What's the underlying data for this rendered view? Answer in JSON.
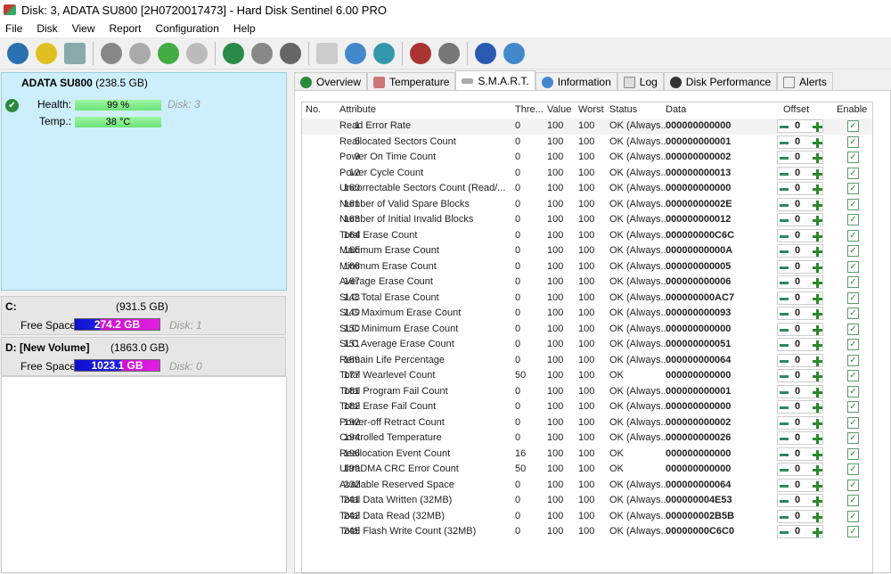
{
  "window": {
    "title": "Disk: 3, ADATA SU800 [2H0720017473]  -  Hard Disk Sentinel 6.00 PRO"
  },
  "menu": [
    "File",
    "Disk",
    "View",
    "Report",
    "Configuration",
    "Help"
  ],
  "toolbar": {
    "icons": [
      "refresh-icon",
      "alert-icon",
      "disk-icon",
      "cloud-disk-icon",
      "disk-clock-icon",
      "disk-check-icon",
      "disk-search-icon",
      "globe-disk-icon",
      "network-icon",
      "computer-icon",
      "report-icon",
      "update-icon",
      "web-icon",
      "monitor-icon",
      "speaker-icon",
      "help-icon",
      "info-icon"
    ]
  },
  "disk": {
    "name": "ADATA SU800",
    "size": "(238.5 GB)",
    "health_label": "Health:",
    "health": "99 %",
    "health_value": 99,
    "temp_label": "Temp.:",
    "temp": "38 °C",
    "disk_no": "Disk: 3"
  },
  "volumes": [
    {
      "name": "C:",
      "size": "(931.5 GB)",
      "free_label": "Free Space",
      "free": "274.2 GB",
      "free_fraction": 0.294,
      "disk": "Disk: 1"
    },
    {
      "name": "D: [New Volume]",
      "size": "(1863.0 GB)",
      "free_label": "Free Space",
      "free": "1023.1 GB",
      "free_fraction": 0.549,
      "disk": "Disk: 0"
    }
  ],
  "tabs": [
    "Overview",
    "Temperature",
    "S.M.A.R.T.",
    "Information",
    "Log",
    "Disk Performance",
    "Alerts"
  ],
  "smart": {
    "headers": {
      "no": "No.",
      "attr": "Attribute",
      "thre": "Thre...",
      "value": "Value",
      "worst": "Worst",
      "status": "Status",
      "data": "Data",
      "offset": "Offset",
      "enable": "Enable"
    },
    "rows": [
      [
        "1",
        "Read Error Rate",
        "0",
        "100",
        "100",
        "OK (Always...",
        "000000000000"
      ],
      [
        "5",
        "Reallocated Sectors Count",
        "0",
        "100",
        "100",
        "OK (Always...",
        "000000000001"
      ],
      [
        "9",
        "Power On Time Count",
        "0",
        "100",
        "100",
        "OK (Always...",
        "000000000002"
      ],
      [
        "12",
        "Power Cycle Count",
        "0",
        "100",
        "100",
        "OK (Always...",
        "000000000013"
      ],
      [
        "160",
        "Uncorrectable Sectors Count (Read/...",
        "0",
        "100",
        "100",
        "OK (Always...",
        "000000000000"
      ],
      [
        "161",
        "Number of Valid Spare Blocks",
        "0",
        "100",
        "100",
        "OK (Always...",
        "00000000002E"
      ],
      [
        "163",
        "Number of Initial Invalid Blocks",
        "0",
        "100",
        "100",
        "OK (Always...",
        "000000000012"
      ],
      [
        "164",
        "Total Erase Count",
        "0",
        "100",
        "100",
        "OK (Always...",
        "000000000C6C"
      ],
      [
        "165",
        "Maximum Erase Count",
        "0",
        "100",
        "100",
        "OK (Always...",
        "00000000000A"
      ],
      [
        "166",
        "Minimum Erase Count",
        "0",
        "100",
        "100",
        "OK (Always...",
        "000000000005"
      ],
      [
        "167",
        "Average Erase Count",
        "0",
        "100",
        "100",
        "OK (Always...",
        "000000000006"
      ],
      [
        "148",
        "SLC Total Erase Count",
        "0",
        "100",
        "100",
        "OK (Always...",
        "000000000AC7"
      ],
      [
        "149",
        "SLC Maximum Erase Count",
        "0",
        "100",
        "100",
        "OK (Always...",
        "000000000093"
      ],
      [
        "150",
        "SLC Minimum Erase Count",
        "0",
        "100",
        "100",
        "OK (Always...",
        "000000000000"
      ],
      [
        "151",
        "SLC Average Erase Count",
        "0",
        "100",
        "100",
        "OK (Always...",
        "000000000051"
      ],
      [
        "169",
        "Remain Life Percentage",
        "0",
        "100",
        "100",
        "OK (Always...",
        "000000000064"
      ],
      [
        "177",
        "Total Wearlevel Count",
        "50",
        "100",
        "100",
        "OK",
        "000000000000"
      ],
      [
        "181",
        "Total Program Fail Count",
        "0",
        "100",
        "100",
        "OK (Always...",
        "000000000001"
      ],
      [
        "182",
        "Total Erase Fail Count",
        "0",
        "100",
        "100",
        "OK (Always...",
        "000000000000"
      ],
      [
        "192",
        "Power-off Retract Count",
        "0",
        "100",
        "100",
        "OK (Always...",
        "000000000002"
      ],
      [
        "194",
        "Controlled Temperature",
        "0",
        "100",
        "100",
        "OK (Always...",
        "000000000026"
      ],
      [
        "196",
        "Reallocation Event Count",
        "16",
        "100",
        "100",
        "OK",
        "000000000000"
      ],
      [
        "199",
        "UltraDMA CRC Error Count",
        "50",
        "100",
        "100",
        "OK",
        "000000000000"
      ],
      [
        "232",
        "Available Reserved Space",
        "0",
        "100",
        "100",
        "OK (Always...",
        "000000000064"
      ],
      [
        "241",
        "Total Data Written (32MB)",
        "0",
        "100",
        "100",
        "OK (Always...",
        "000000004E53"
      ],
      [
        "242",
        "Total Data Read (32MB)",
        "0",
        "100",
        "100",
        "OK (Always...",
        "000000002B5B"
      ],
      [
        "245",
        "Total Flash Write Count (32MB)",
        "0",
        "100",
        "100",
        "OK (Always...",
        "00000000C6C0"
      ]
    ],
    "offset": "0",
    "enabled": true
  }
}
